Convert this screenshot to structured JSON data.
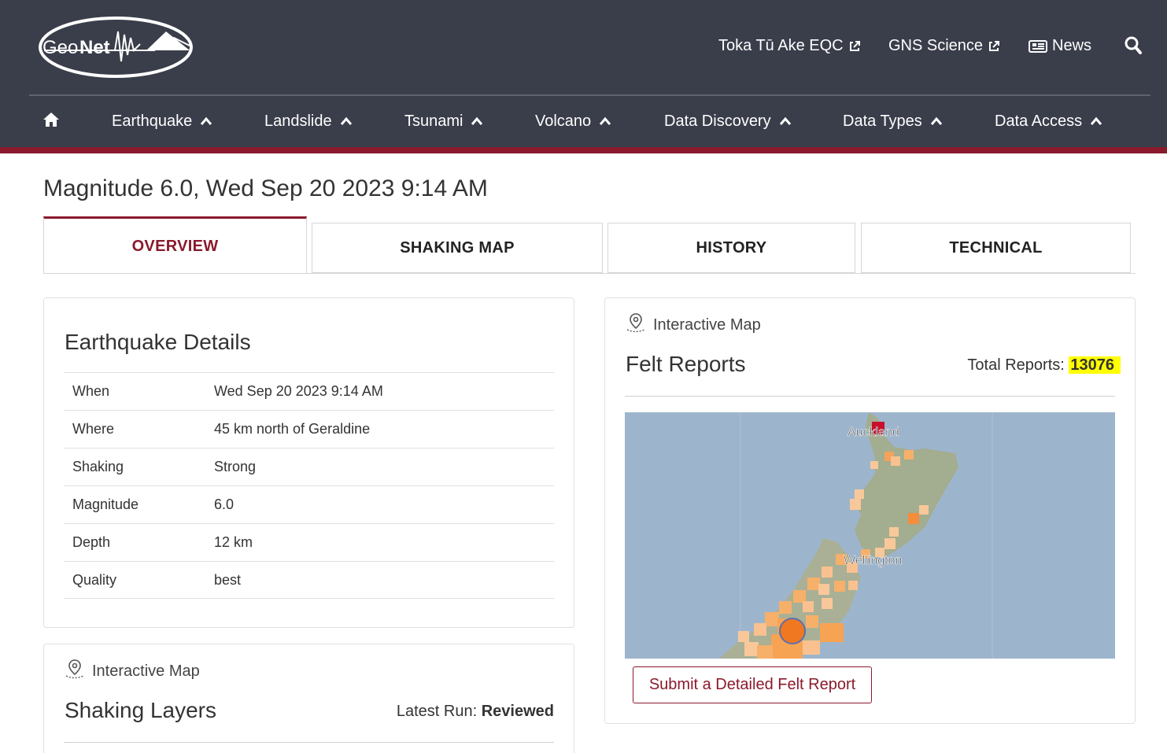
{
  "header": {
    "logo": {
      "text_geo": "Geo",
      "text_net": "Net"
    },
    "top_links": [
      {
        "label": "Toka Tū Ake EQC",
        "icon": "external-link-icon"
      },
      {
        "label": "GNS Science",
        "icon": "external-link-icon"
      },
      {
        "label": "News",
        "icon": "newspaper-icon"
      }
    ],
    "search_icon": "search-icon"
  },
  "nav": {
    "home_icon": "home-icon",
    "items": [
      {
        "label": "Earthquake",
        "active": true
      },
      {
        "label": "Landslide"
      },
      {
        "label": "Tsunami"
      },
      {
        "label": "Volcano"
      },
      {
        "label": "Data Discovery"
      },
      {
        "label": "Data Types"
      },
      {
        "label": "Data Access"
      }
    ]
  },
  "page": {
    "title": "Magnitude 6.0, Wed Sep 20 2023 9:14 AM"
  },
  "tabs": [
    {
      "label": "OVERVIEW",
      "active": true
    },
    {
      "label": "SHAKING MAP"
    },
    {
      "label": "HISTORY"
    },
    {
      "label": "TECHNICAL"
    }
  ],
  "details": {
    "title": "Earthquake Details",
    "rows": [
      {
        "key": "When",
        "value": "Wed Sep 20 2023 9:14 AM"
      },
      {
        "key": "Where",
        "value": "45 km north of Geraldine"
      },
      {
        "key": "Shaking",
        "value": "Strong"
      },
      {
        "key": "Magnitude",
        "value": "6.0"
      },
      {
        "key": "Depth",
        "value": "12 km"
      },
      {
        "key": "Quality",
        "value": "best"
      }
    ]
  },
  "shaking": {
    "map_label": "Interactive Map",
    "title": "Shaking Layers",
    "latest_run_label": "Latest Run:",
    "latest_run_value": "Reviewed"
  },
  "felt": {
    "map_label": "Interactive Map",
    "title": "Felt Reports",
    "total_label": "Total Reports:",
    "total_value": "13076",
    "map_city_1": "Auckland",
    "map_city_2": "Wellington",
    "button": "Submit a Detailed Felt Report"
  },
  "colors": {
    "header_bg": "#3a3d4a",
    "accent": "#8a1a2c",
    "highlight": "#ffff00"
  }
}
